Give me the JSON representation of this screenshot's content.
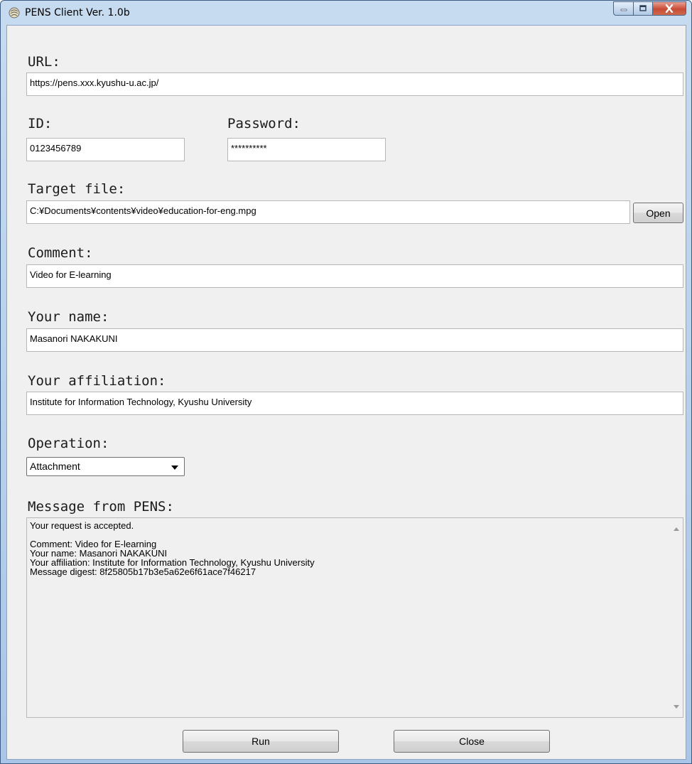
{
  "window": {
    "title": "PENS Client Ver. 1.0b"
  },
  "fields": {
    "url_label": "URL:",
    "url_value": "https://pens.xxx.kyushu-u.ac.jp/",
    "id_label": "ID:",
    "id_value": "0123456789",
    "password_label": "Password:",
    "password_value": "**********",
    "target_label": "Target file:",
    "target_value": "C:¥Documents¥contents¥video¥education-for-eng.mpg",
    "open_label": "Open",
    "comment_label": "Comment:",
    "comment_value": "Video for E-learning",
    "name_label": "Your name:",
    "name_value": "Masanori NAKAKUNI",
    "affiliation_label": "Your affiliation:",
    "affiliation_value": "Institute for Information Technology, Kyushu University",
    "operation_label": "Operation:",
    "operation_value": "Attachment",
    "message_label": "Message from PENS:"
  },
  "message": {
    "lines": [
      "Your request is accepted.",
      "",
      "Comment: Video for E-learning",
      "Your name: Masanori NAKAKUNI",
      "Your affiliation: Institute for Information Technology, Kyushu University",
      "Message digest: 8f25805b17b3e5a62e6f61ace7f46217"
    ]
  },
  "buttons": {
    "run": "Run",
    "close": "Close"
  },
  "icons": {
    "app": "pens-app-icon",
    "minimize": "minimize-icon",
    "maximize": "maximize-icon",
    "close": "close-icon"
  },
  "colors": {
    "close_button": "#c74b34",
    "titlebar": "#b9d1ea"
  }
}
